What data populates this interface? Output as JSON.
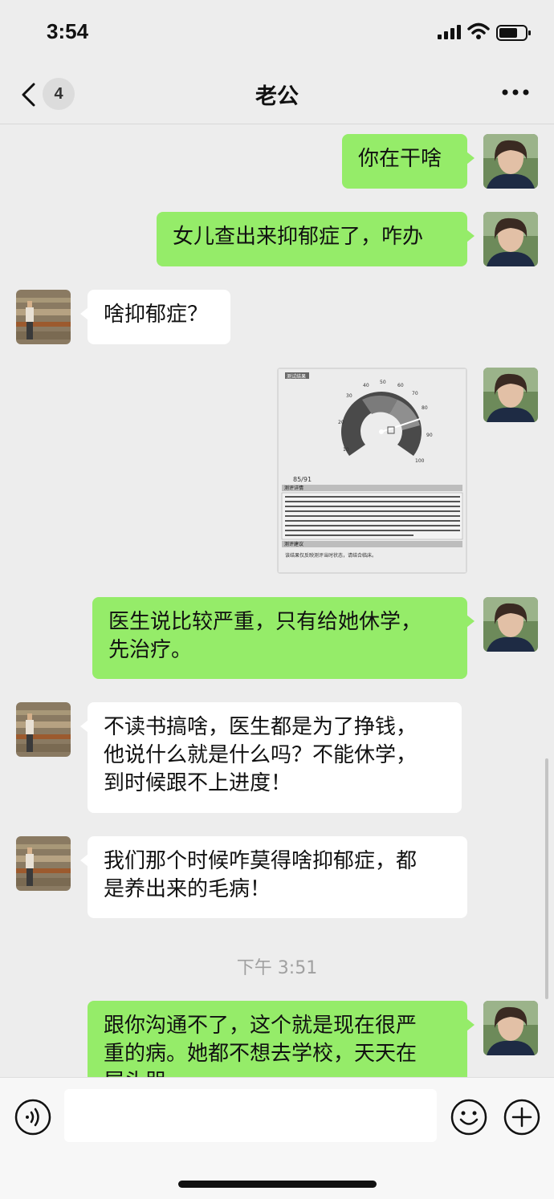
{
  "status_bar": {
    "time": "3:54"
  },
  "header": {
    "unread_count": "4",
    "title": "老公"
  },
  "messages": [
    {
      "sender": "me",
      "text": "你在干啥"
    },
    {
      "sender": "me",
      "text": "女儿查出来抑郁症了，咋办"
    },
    {
      "sender": "them",
      "text": "啥抑郁症？"
    },
    {
      "sender": "me",
      "type": "image",
      "image_labels": {
        "title": "测试结果",
        "gauge_ticks": [
          "30",
          "40",
          "50",
          "60",
          "70",
          "80",
          "90",
          "20",
          "10",
          "100"
        ],
        "score": "85/91",
        "section1": "测评详情",
        "section2": "测评建议",
        "footer": "该结果仅反映测评当时状态，请结合临床。"
      }
    },
    {
      "sender": "me",
      "lines": [
        "医生说比较严重，只有给她休学，",
        "先治疗。"
      ]
    },
    {
      "sender": "them",
      "lines": [
        "不读书搞啥，医生都是为了挣钱，",
        "他说什么就是什么吗？不能休学，",
        "到时候跟不上进度！"
      ]
    },
    {
      "sender": "them",
      "lines": [
        "我们那个时候咋莫得啥抑郁症，都",
        "是养出来的毛病！"
      ]
    },
    {
      "sender": "me",
      "lines": [
        "跟你沟通不了，这个就是现在很严",
        "重的病。她都不想去学校，天天在",
        "屋头哭"
      ]
    }
  ],
  "timestamp": "下午 3:51",
  "input": {
    "value": "",
    "placeholder": ""
  },
  "icons": {
    "back": "chevron-left-icon",
    "more": "more-dots-icon",
    "voice": "voice-icon",
    "emoji": "emoji-icon",
    "plus": "plus-icon"
  },
  "colors": {
    "chat_background": "#ededed",
    "my_bubble": "#95ec69",
    "their_bubble": "#ffffff",
    "timestamp_text": "#a0a0a0"
  }
}
